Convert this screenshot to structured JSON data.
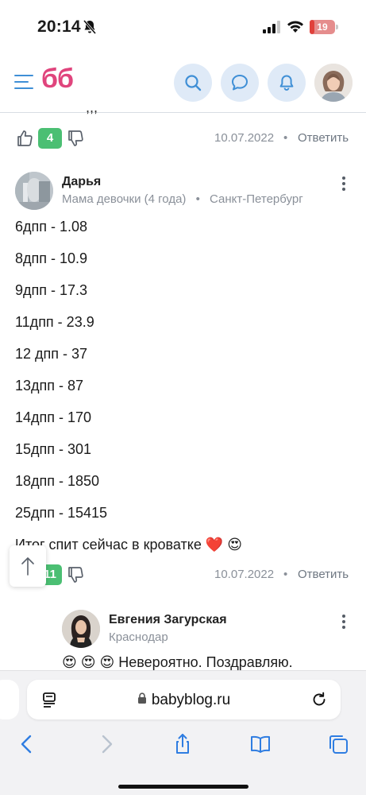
{
  "status_bar": {
    "time": "20:14",
    "battery": "19",
    "battery_level": 0.19
  },
  "header": {
    "logo": "бб",
    "icons": [
      "menu-icon",
      "search-icon",
      "chat-icon",
      "notification-bell-icon",
      "user-avatar"
    ]
  },
  "prev_comment": {
    "cut_text": ",,,",
    "votes": "4",
    "date": "10.07.2022",
    "dot": "•",
    "reply": "Ответить"
  },
  "comment": {
    "author": "Дарья",
    "status": "Мама девочки (4 года)",
    "dot": "•",
    "city": "Санкт-Петербург",
    "lines": [
      "6дпп - 1.08",
      "8дпп - 10.9",
      "9дпп - 17.3",
      "11дпп - 23.9",
      "12 дпп - 37",
      "13дпп - 87",
      "14дпп - 170",
      "15дпп - 301",
      "18дпп - 1850",
      "25дпп - 15415",
      "Итог спит сейчас в кроватке ❤️ 😍"
    ],
    "votes": "11",
    "date": "10.07.2022",
    "reply": "Ответить"
  },
  "reply_comment": {
    "author": "Евгения Загурская",
    "city": "Краснодар",
    "text": "😍 😍 😍  Невероятно. Поздравляю."
  },
  "browser": {
    "url": "babyblog.ru"
  },
  "colors": {
    "brand_pink": "#e0457d",
    "accent_blue": "#3f8fd6",
    "vote_green": "#4bbf73",
    "header_button_bg": "#dfeaf7"
  }
}
